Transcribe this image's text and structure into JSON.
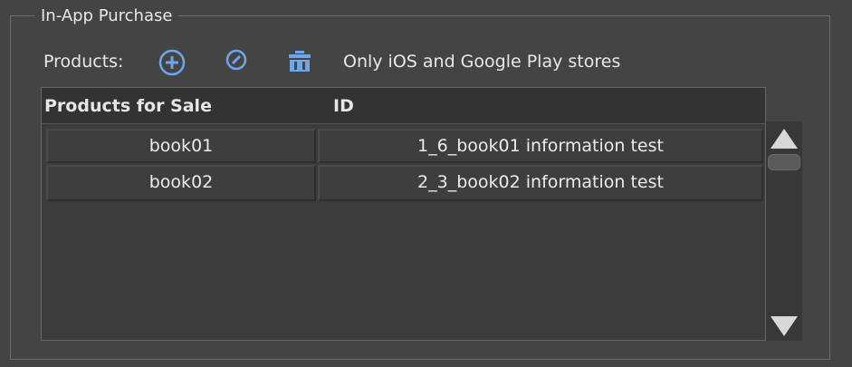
{
  "group": {
    "title": "In-App Purchase"
  },
  "toolbar": {
    "label": "Products:",
    "icons": [
      "add-circle-icon",
      "compass-icon",
      "trash-icon"
    ],
    "note": "Only iOS and Google Play stores"
  },
  "table": {
    "columns": [
      "Products for Sale",
      "ID"
    ],
    "rows": [
      [
        "book01",
        "1_6_book01 information test"
      ],
      [
        "book02",
        "2_3_book02 information test"
      ]
    ]
  },
  "colors": {
    "background": "#444444",
    "accent": "#6ea6e8",
    "text": "#e8e8e8"
  }
}
